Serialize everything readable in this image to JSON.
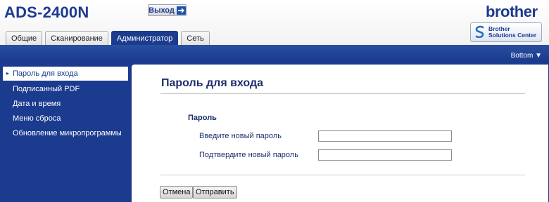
{
  "header": {
    "model": "ADS-2400N",
    "logout_label": "Выход",
    "brand": "brother",
    "solutions_center": {
      "line1": "Brother",
      "line2": "Solutions Center"
    }
  },
  "tabs": [
    {
      "label": "Общие",
      "active": false
    },
    {
      "label": "Сканирование",
      "active": false
    },
    {
      "label": "Администратор",
      "active": true
    },
    {
      "label": "Сеть",
      "active": false
    }
  ],
  "band": {
    "bottom_link": "Bottom ▼"
  },
  "sidebar": {
    "items": [
      {
        "label": "Пароль для входа",
        "active": true
      },
      {
        "label": "Подписанный PDF",
        "active": false
      },
      {
        "label": "Дата и время",
        "active": false
      },
      {
        "label": "Меню сброса",
        "active": false
      },
      {
        "label": "Обновление микропрограммы",
        "active": false
      }
    ]
  },
  "main": {
    "title": "Пароль для входа",
    "section": "Пароль",
    "new_password_label": "Введите новый пароль",
    "new_password_value": "",
    "confirm_password_label": "Подтвердите новый пароль",
    "confirm_password_value": "",
    "cancel_label": "Отмена",
    "submit_label": "Отправить"
  },
  "colors": {
    "brand_blue": "#1a3b8e",
    "title_text": "#1d2f6d"
  }
}
